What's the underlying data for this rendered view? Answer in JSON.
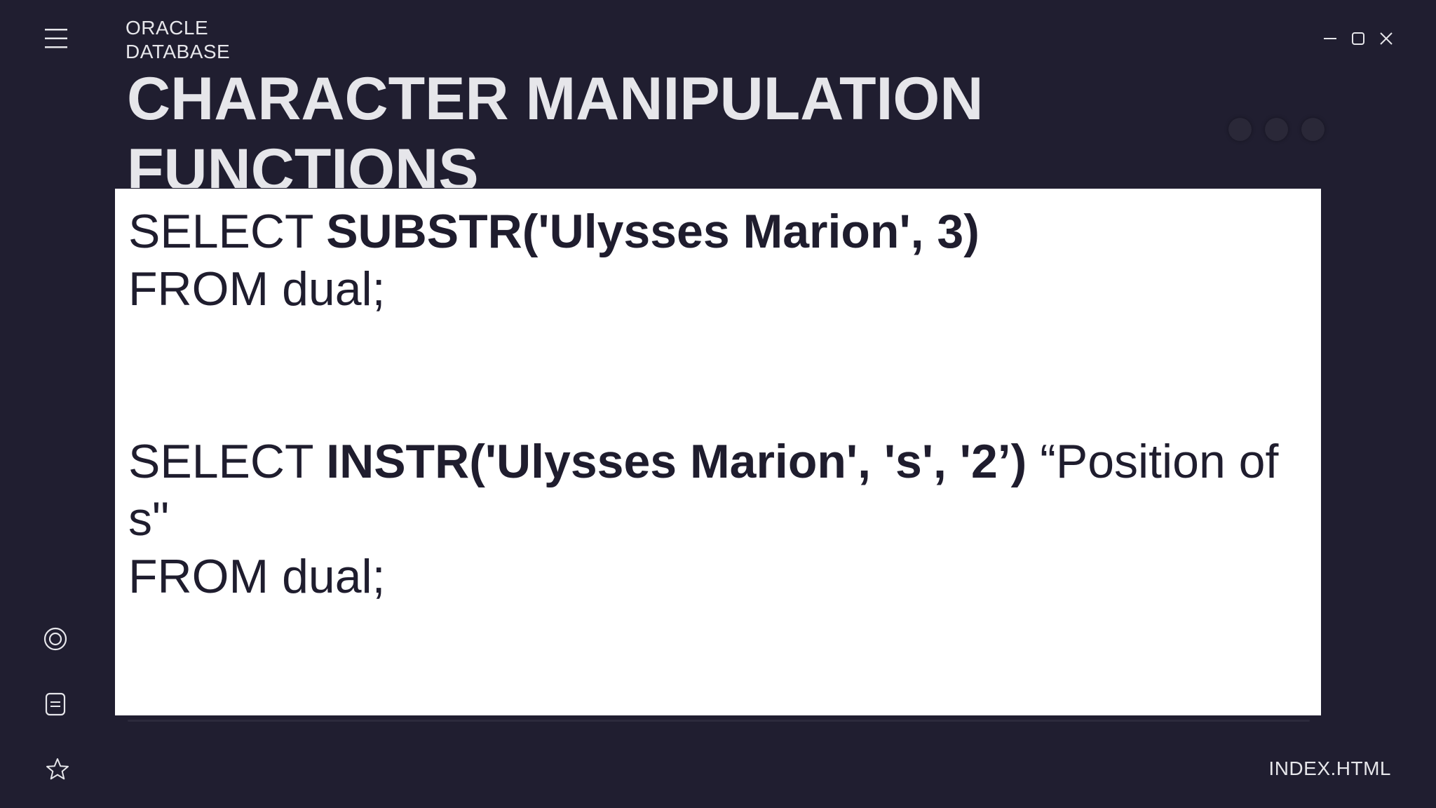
{
  "header": {
    "brand_line1": "ORACLE",
    "brand_line2": "DATABASE",
    "title_line1": "CHARACTER MANIPULATION",
    "title_line2": "FUNCTIONS"
  },
  "window_controls": {
    "icons": [
      "minimize-icon",
      "maximize-icon",
      "close-icon"
    ]
  },
  "slide": {
    "block1": {
      "line1_prefix": "SELECT ",
      "line1_bold": "SUBSTR('Ulysses Marion', 3)",
      "line2": "FROM dual;"
    },
    "block2": {
      "line1_prefix": "SELECT ",
      "line1_bold": "INSTR('Ulysses Marion', 's', '2’)",
      "line1_suffix": " “Position of",
      "line2": "s\"",
      "line3": "FROM dual;"
    }
  },
  "sidebar": {
    "icons": [
      "target-icon",
      "document-icon",
      "star-icon"
    ]
  },
  "footer": {
    "filename": "INDEX.HTML"
  },
  "colors": {
    "background": "#201e30",
    "text_light": "#e6e6ea",
    "card": "#ffffff",
    "text_dark": "#1f1d2e"
  }
}
